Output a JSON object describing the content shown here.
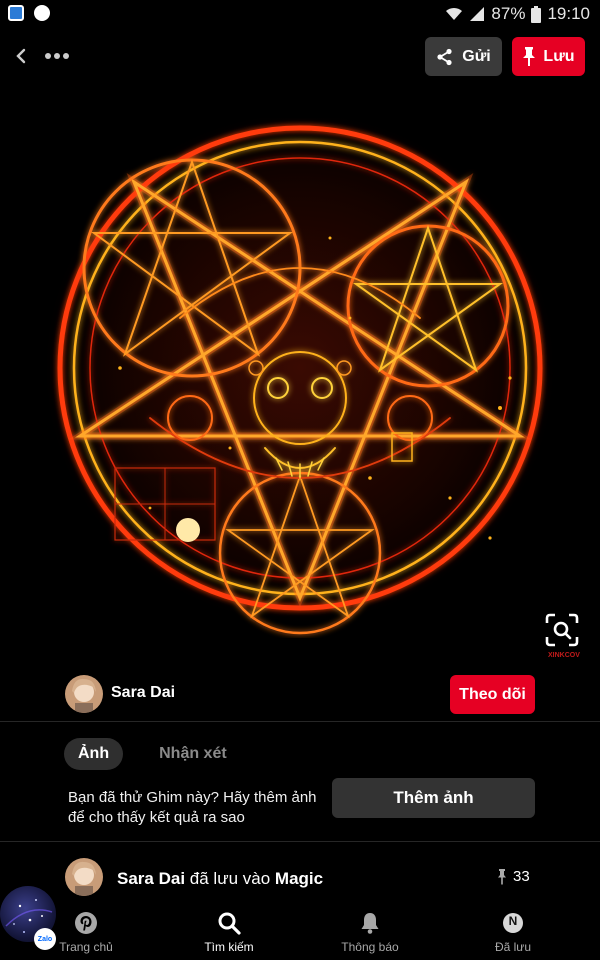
{
  "status_bar": {
    "battery": "87%",
    "time": "19:10"
  },
  "top_bar": {
    "send_label": "Gửi",
    "save_label": "Lưu"
  },
  "pin": {
    "watermark": "XINKCOV"
  },
  "author": {
    "name": "Sara Dai",
    "follow_label": "Theo dõi"
  },
  "tabs": [
    {
      "label": "Ảnh",
      "active": true
    },
    {
      "label": "Nhận xét",
      "active": false
    }
  ],
  "photo_prompt": {
    "text": "Bạn đã thử Ghim này? Hãy thêm ảnh để cho thấy kết quả ra sao",
    "button_label": "Thêm ảnh"
  },
  "saved_info": {
    "user": "Sara Dai",
    "verb": "đã lưu vào",
    "board": "Magic",
    "pin_count": "33"
  },
  "nav": [
    {
      "label": "Trang chủ",
      "icon": "pinterest-icon"
    },
    {
      "label": "Tìm kiếm",
      "icon": "search-icon",
      "active": true
    },
    {
      "label": "Thông báo",
      "icon": "bell-icon"
    },
    {
      "label": "Đã lưu",
      "icon": "profile-icon"
    }
  ],
  "profile_initial": "N",
  "chat_head": {
    "badge": "Zalo"
  },
  "colors": {
    "accent": "#e60023",
    "background": "#000000",
    "button_dark": "#333333",
    "glow_orange": "#ff6a1a"
  }
}
